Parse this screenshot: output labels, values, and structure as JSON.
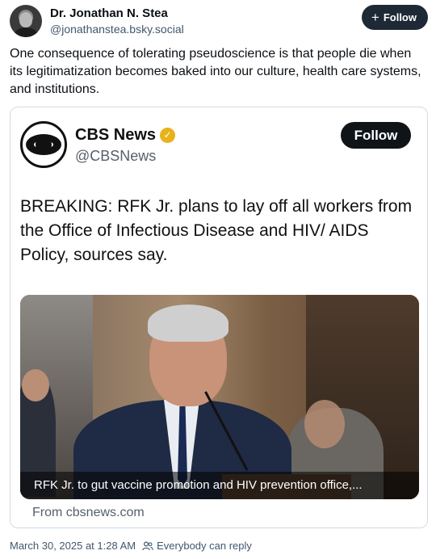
{
  "author": {
    "display_name": "Dr. Jonathan N. Stea",
    "handle": "@jonathanstea.bsky.social",
    "follow_label": "Follow"
  },
  "post": {
    "text": "One consequence of tolerating pseudoscience is that people die when its legitimatization becomes baked into our culture, health care systems, and institutions."
  },
  "embed": {
    "name": "CBS News",
    "handle": "@CBSNews",
    "follow_label": "Follow",
    "headline": "BREAKING: RFK Jr. plans to lay off all workers from the Office of Infectious Disease and HIV/ AIDS Policy, sources say.",
    "media_caption": "RFK Jr. to gut vaccine promotion and HIV prevention office,...",
    "source": "From cbsnews.com"
  },
  "footer": {
    "timestamp": "March 30, 2025 at 1:28 AM",
    "reply_setting": "Everybody can reply"
  },
  "colors": {
    "follow_button_bg": "#1e2936",
    "verified_badge": "#e8b21a",
    "muted_text": "#42576c"
  }
}
